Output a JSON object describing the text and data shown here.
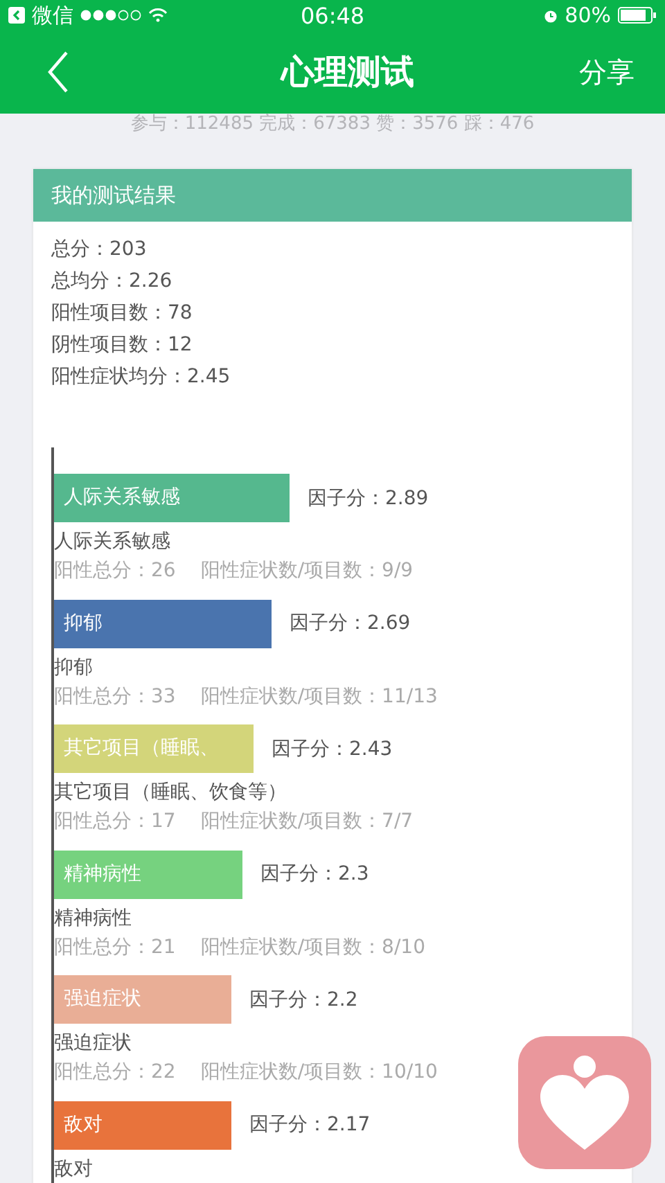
{
  "status_bar": {
    "back_app": "微信",
    "time": "06:48",
    "battery": "80%"
  },
  "nav": {
    "title": "心理测试",
    "action": "分享"
  },
  "stats_line": "参与：112485 完成：67383 赞：3576 踩：476",
  "card": {
    "title": "我的测试结果",
    "summary": [
      "总分：203",
      "总均分：2.26",
      "阳性项目数：78",
      "阴性项目数：12",
      "阳性症状均分：2.45"
    ],
    "factors": [
      {
        "bar_label": "人际关系敏感",
        "score": "因子分：2.89",
        "name": "人际关系敏感",
        "total": "阳性总分：26",
        "ratio": "阳性症状数/项目数：9/9",
        "color": "#55b88e"
      },
      {
        "bar_label": "抑郁",
        "score": "因子分：2.69",
        "name": "抑郁",
        "total": "阳性总分：33",
        "ratio": "阳性症状数/项目数：11/13",
        "color": "#4a74ae"
      },
      {
        "bar_label": "其它项目（睡眠、",
        "score": "因子分：2.43",
        "name": "其它项目（睡眠、饮食等）",
        "total": "阳性总分：17",
        "ratio": "阳性症状数/项目数：7/7",
        "color": "#d3d57a"
      },
      {
        "bar_label": "精神病性",
        "score": "因子分：2.3",
        "name": "精神病性",
        "total": "阳性总分：21",
        "ratio": "阳性症状数/项目数：8/10",
        "color": "#76d27f"
      },
      {
        "bar_label": "强迫症状",
        "score": "因子分：2.2",
        "name": "强迫症状",
        "total": "阳性总分：22",
        "ratio": "阳性症状数/项目数：10/10",
        "color": "#e9ae96"
      },
      {
        "bar_label": "敌对",
        "score": "因子分：2.17",
        "name": "敌对",
        "color": "#e8733c"
      }
    ]
  }
}
